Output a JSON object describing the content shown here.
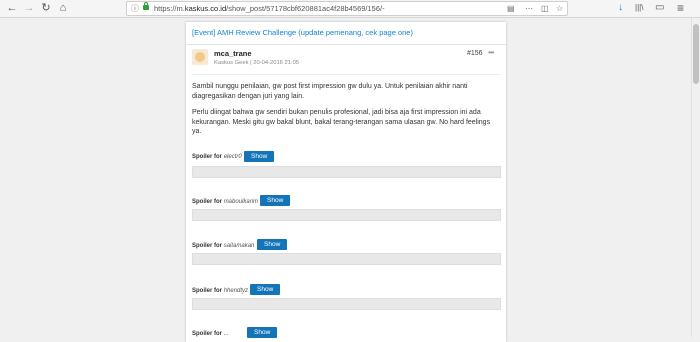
{
  "browser": {
    "url_prefix": "https://m.",
    "url_domain": "kaskus.co.id",
    "url_path": "/show_post/57178cbf620881ac4f28b4569/156/-",
    "back": "←",
    "forward": "→",
    "reload": "↻",
    "home": "⌂",
    "info": "ⓘ",
    "reader": "▤",
    "pocket": "◫",
    "bookmark": "☆",
    "menu_dots": "⋯",
    "download": "↓",
    "library": "|||\\",
    "sidebar": "▭",
    "hamburger": "≡"
  },
  "thread": {
    "title": "[Event] AMH Review Challenge (update pemenang, cek page one)"
  },
  "post": {
    "username": "mca_trane",
    "rank": "Kaskus Geek",
    "separator": "|",
    "date": "20-04-2016 21:05",
    "number": "#156",
    "more": "•••",
    "paragraph1": "Sambil nunggu penilaian, gw post first impression gw dulu ya. Untuk penilaian akhir nanti diagregasikan dengan juri yang lain.",
    "paragraph2": "Perlu diingat bahwa gw sendiri bukan penulis profesional, jadi bisa aja first impression ini ada kekurangan. Meski gitu gw bakal blunt, bakal terang-terangan sama ulasan gw. No hard feelings ya."
  },
  "spoilers": {
    "prefix": "Spoiler for",
    "show_label": "Show",
    "items": [
      {
        "name": "electr0"
      },
      {
        "name": "maboulkarim"
      },
      {
        "name": "saitamakan"
      },
      {
        "name": "hhendtyz"
      },
      {
        "name": "..."
      }
    ]
  }
}
